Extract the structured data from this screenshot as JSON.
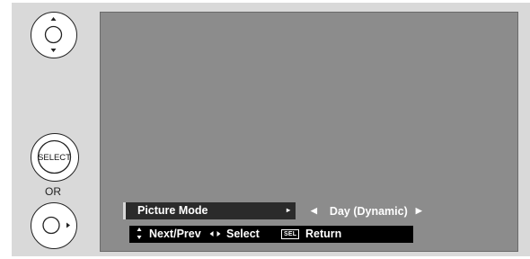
{
  "remote": {
    "select_label": "SELECT",
    "or_label": "OR",
    "icons": [
      "up-down-button-icon",
      "select-button-icon",
      "right-button-icon"
    ]
  },
  "menu": {
    "item_label": "Picture Mode",
    "item_arrow": "▸",
    "value_left": "◀",
    "value": "Day (Dynamic)",
    "value_right": "▶"
  },
  "help_bar": {
    "next_prev_label": "Next/Prev",
    "select_label": "Select",
    "sel_key": "SEL",
    "return_label": "Return"
  },
  "colors": {
    "screen": "#8c8c8c",
    "panel": "#d9d9d9",
    "menu_bar": "#000000"
  }
}
